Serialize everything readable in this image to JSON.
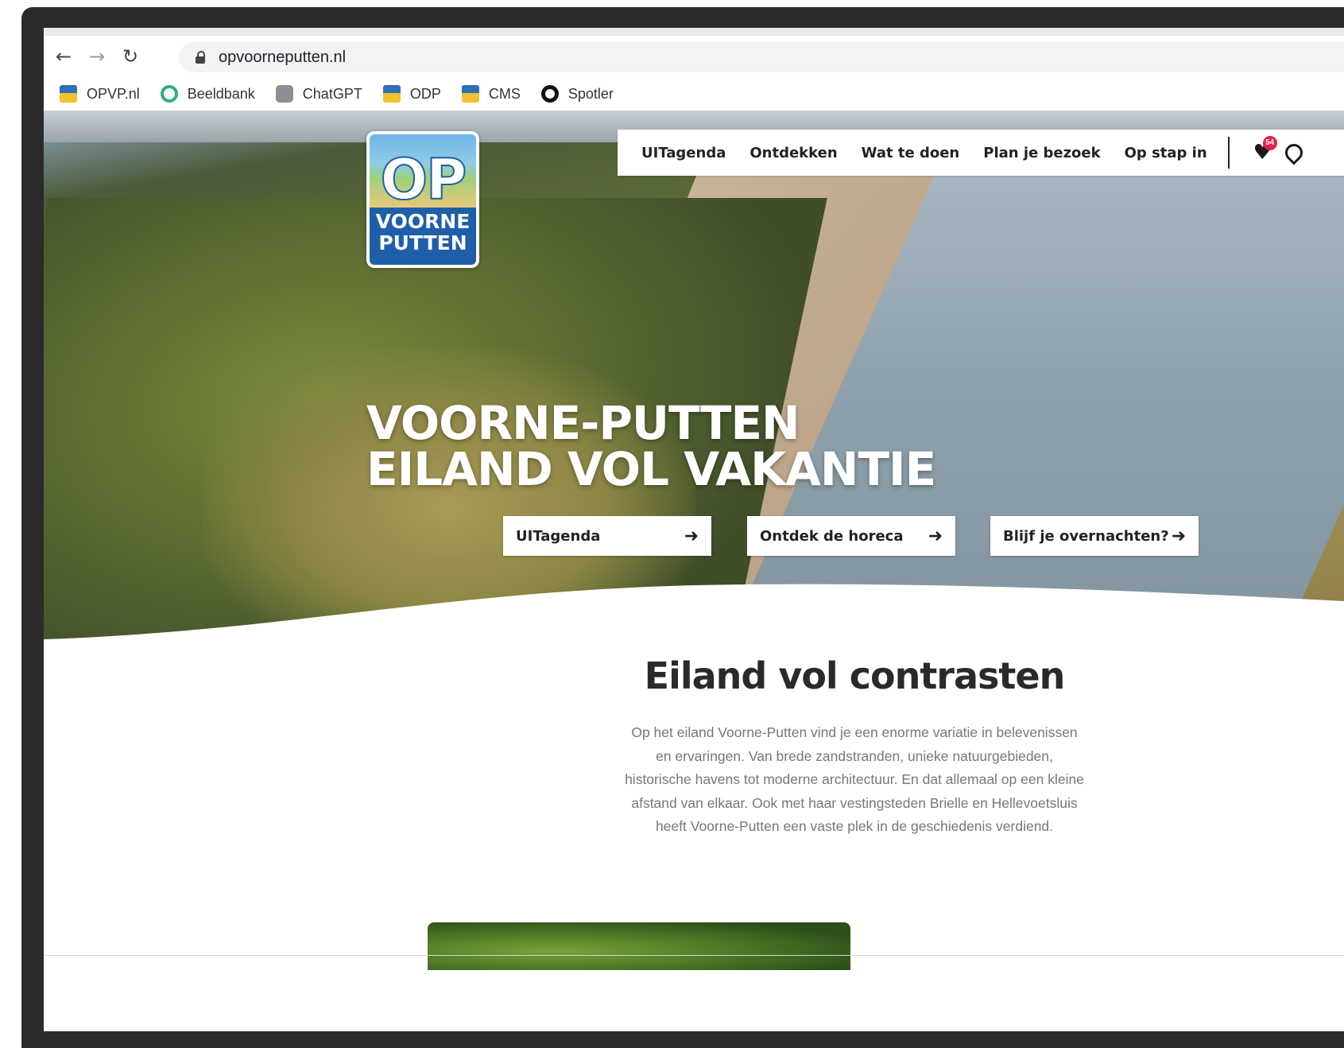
{
  "browser": {
    "back_icon": "arrow-left-icon",
    "forward_icon": "arrow-right-icon",
    "reload_icon": "reload-icon",
    "url": "opvoorneputten.nl"
  },
  "bookmarks": [
    {
      "label": "OPVP.nl",
      "icon": "flag-icon"
    },
    {
      "label": "Beeldbank",
      "icon": "ring-icon"
    },
    {
      "label": "ChatGPT",
      "icon": "chatgpt-icon"
    },
    {
      "label": "ODP",
      "icon": "flag-icon"
    },
    {
      "label": "CMS",
      "icon": "flag-icon"
    },
    {
      "label": "Spotler",
      "icon": "spotler-icon"
    }
  ],
  "logo": {
    "line1": "OP",
    "line2": "VOORNE",
    "line3": "PUTTEN"
  },
  "nav": {
    "items": [
      "UITagenda",
      "Ontdekken",
      "Wat te doen",
      "Plan je bezoek",
      "Op stap in"
    ],
    "favorites_count": "54"
  },
  "hero": {
    "title_line1": "VOORNE-PUTTEN",
    "title_line2": "EILAND VOL VAKANTIE",
    "buttons": [
      "UITagenda",
      "Ontdek de horeca",
      "Blijf je overnachten?"
    ]
  },
  "intro": {
    "title": "Eiland vol contrasten",
    "text": "Op het eiland Voorne-Putten vind je een enorme variatie in belevenissen en ervaringen. Van brede zandstranden, unieke natuurgebieden, historische havens tot moderne architectuur. En dat allemaal op een kleine afstand van elkaar. Ook met haar vestingsteden Brielle en Hellevoetsluis heeft Voorne-Putten een vaste plek in de geschiedenis verdiend."
  },
  "colors": {
    "accent": "#1f5ea8",
    "badge": "#e0224b"
  }
}
